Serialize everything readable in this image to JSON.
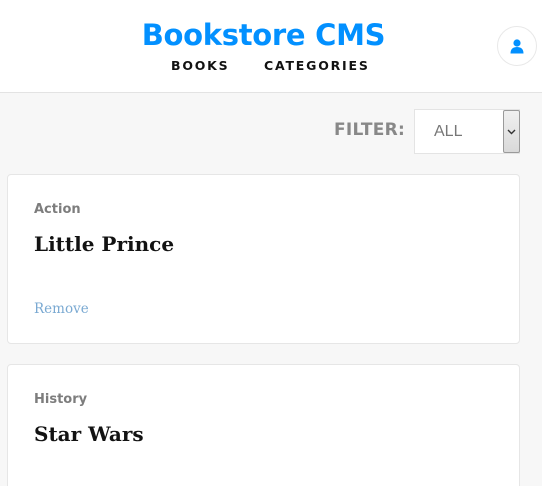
{
  "header": {
    "title": "Bookstore CMS",
    "nav": [
      {
        "label": "BOOKS"
      },
      {
        "label": "CATEGORIES"
      }
    ],
    "avatar_icon": "user-icon"
  },
  "filter": {
    "label": "FILTER:",
    "selected": "ALL"
  },
  "books": [
    {
      "category": "Action",
      "title": "Little Prince",
      "remove_label": "Remove"
    },
    {
      "category": "History",
      "title": "Star Wars"
    }
  ],
  "colors": {
    "brand": "#0290ff",
    "link": "#4386bf",
    "background": "#f7f7f7"
  }
}
